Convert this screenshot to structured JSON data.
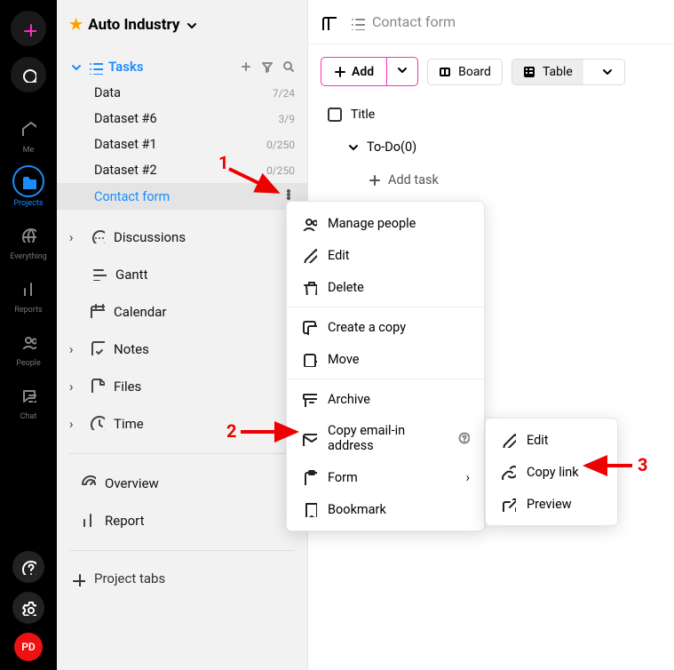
{
  "rail": {
    "items": [
      {
        "label": "Me"
      },
      {
        "label": "Projects"
      },
      {
        "label": "Everything"
      },
      {
        "label": "Reports"
      },
      {
        "label": "People"
      },
      {
        "label": "Chat"
      }
    ],
    "avatar": "PD"
  },
  "project": {
    "title": "Auto Industry",
    "tasks_label": "Tasks",
    "datasets": [
      {
        "name": "Data",
        "count": "7/24"
      },
      {
        "name": "Dataset #6",
        "count": "3/9"
      },
      {
        "name": "Dataset #1",
        "count": "0/250"
      },
      {
        "name": "Dataset #2",
        "count": "0/250"
      }
    ],
    "selected": "Contact form",
    "nav": [
      {
        "label": "Discussions"
      },
      {
        "label": "Gantt"
      },
      {
        "label": "Calendar"
      },
      {
        "label": "Notes"
      },
      {
        "label": "Files"
      },
      {
        "label": "Time"
      }
    ],
    "overview": "Overview",
    "report": "Report",
    "project_tabs": "Project tabs"
  },
  "main": {
    "breadcrumb": "Contact form",
    "add_label": "Add",
    "board_label": "Board",
    "table_label": "Table",
    "title_col": "Title",
    "section": "To-Do(0)",
    "add_task": "Add task"
  },
  "menu": {
    "manage_people": "Manage people",
    "edit": "Edit",
    "delete": "Delete",
    "create_copy": "Create a copy",
    "move": "Move",
    "archive": "Archive",
    "copy_email": "Copy email-in address",
    "form": "Form",
    "bookmark": "Bookmark"
  },
  "submenu": {
    "edit": "Edit",
    "copy_link": "Copy link",
    "preview": "Preview"
  },
  "annotations": {
    "n1": "1",
    "n2": "2",
    "n3": "3"
  }
}
